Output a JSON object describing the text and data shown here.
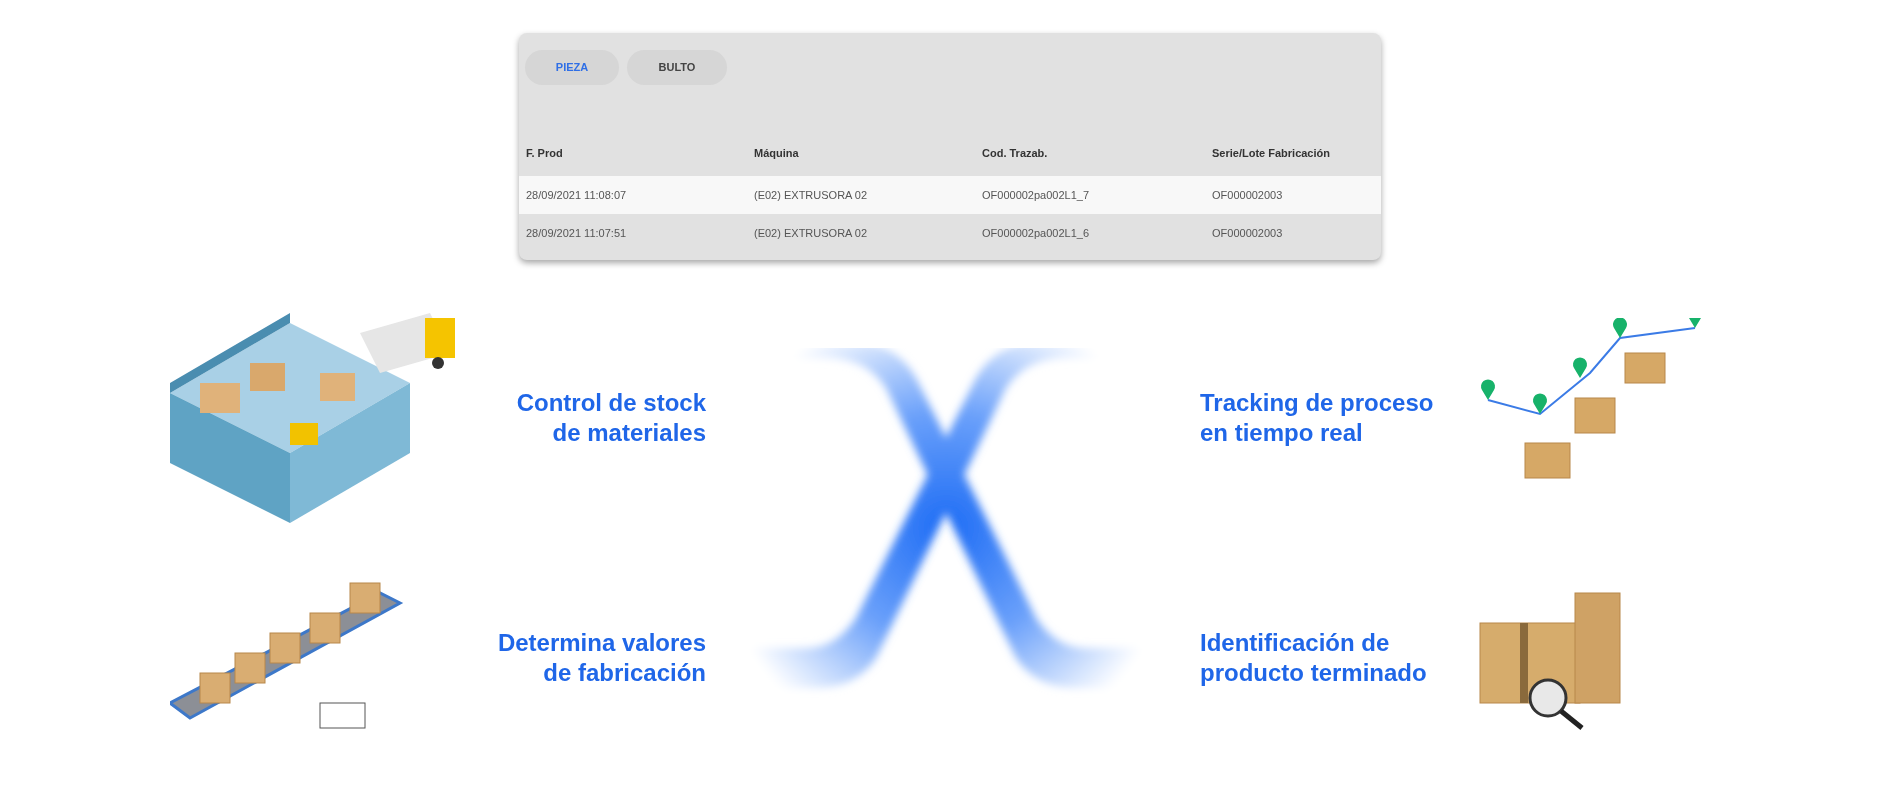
{
  "tabs": [
    {
      "label": "PIEZA",
      "selected": true
    },
    {
      "label": "BULTO",
      "selected": false
    }
  ],
  "table": {
    "columns": [
      "F. Prod",
      "Máquina",
      "Cod. Trazab.",
      "Serie/Lote Fabricación"
    ],
    "rows": [
      [
        "28/09/2021 11:08:07",
        "(E02) EXTRUSORA 02",
        "OF000002pa002L1_7",
        "OF000002003"
      ],
      [
        "28/09/2021 11:07:51",
        "(E02) EXTRUSORA 02",
        "OF000002pa002L1_6",
        "OF000002003"
      ]
    ]
  },
  "feature_rows": [
    {
      "left": [
        "Control de stock",
        "de materiales"
      ],
      "right": [
        "Tracking de proceso",
        "en tiempo real"
      ]
    },
    {
      "left": [
        "Determina valores",
        "de fabricación"
      ],
      "right": [
        "Identificación de",
        "producto terminado"
      ]
    }
  ]
}
